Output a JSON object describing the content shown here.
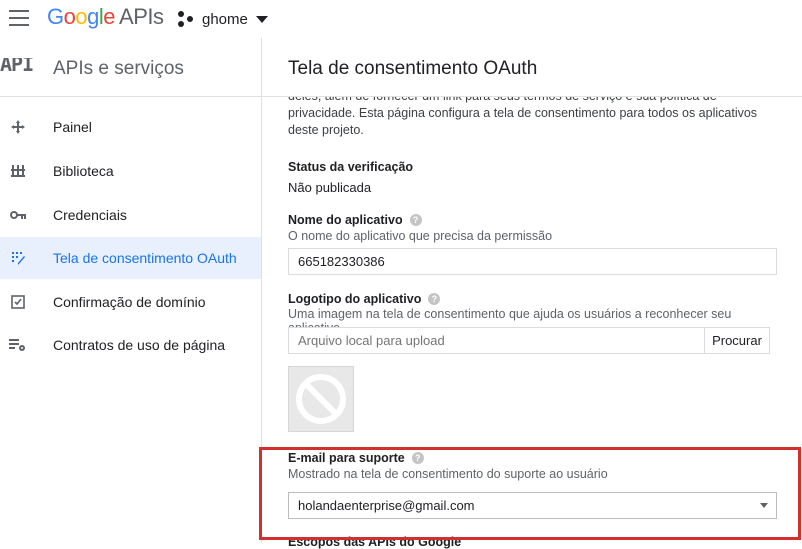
{
  "topbar": {
    "logo_letters": [
      "G",
      "o",
      "o",
      "g",
      "l",
      "e"
    ],
    "logo_product": "APIs",
    "project_name": "ghome"
  },
  "sidebar": {
    "badge": "API",
    "title": "APIs e serviços",
    "items": [
      {
        "label": "Painel",
        "icon": "dashboard-icon",
        "active": false
      },
      {
        "label": "Biblioteca",
        "icon": "library-icon",
        "active": false
      },
      {
        "label": "Credenciais",
        "icon": "key-icon",
        "active": false
      },
      {
        "label": "Tela de consentimento OAuth",
        "icon": "consent-icon",
        "active": true
      },
      {
        "label": "Confirmação de domínio",
        "icon": "checkbox-icon",
        "active": false
      },
      {
        "label": "Contratos de uso de página",
        "icon": "settings-list-icon",
        "active": false
      }
    ]
  },
  "main": {
    "title": "Tela de consentimento OAuth",
    "intro_partial": "deles, além de fornecer um link para seus termos de serviço e sua política de",
    "intro_rest": "privacidade. Esta página configura a tela de consentimento para todos os aplicativos deste projeto.",
    "verification": {
      "label": "Status da verificação",
      "value": "Não publicada"
    },
    "app_name": {
      "label": "Nome do aplicativo",
      "description": "O nome do aplicativo que precisa da permissão",
      "value": "665182330386"
    },
    "app_logo": {
      "label": "Logotipo do aplicativo",
      "description": "Uma imagem na tela de consentimento que ajuda os usuários a reconhecer seu aplicativo",
      "placeholder": "Arquivo local para upload",
      "browse_label": "Procurar"
    },
    "support_email": {
      "label": "E-mail para suporte",
      "description": "Mostrado na tela de consentimento do suporte ao usuário",
      "value": "holandaenterprise@gmail.com"
    },
    "next_section_label": "Escopos das APIs do Google"
  },
  "colors": {
    "accent": "#1a73e8",
    "highlight": "#d32f2f",
    "active_bg": "#e8f0fe"
  }
}
